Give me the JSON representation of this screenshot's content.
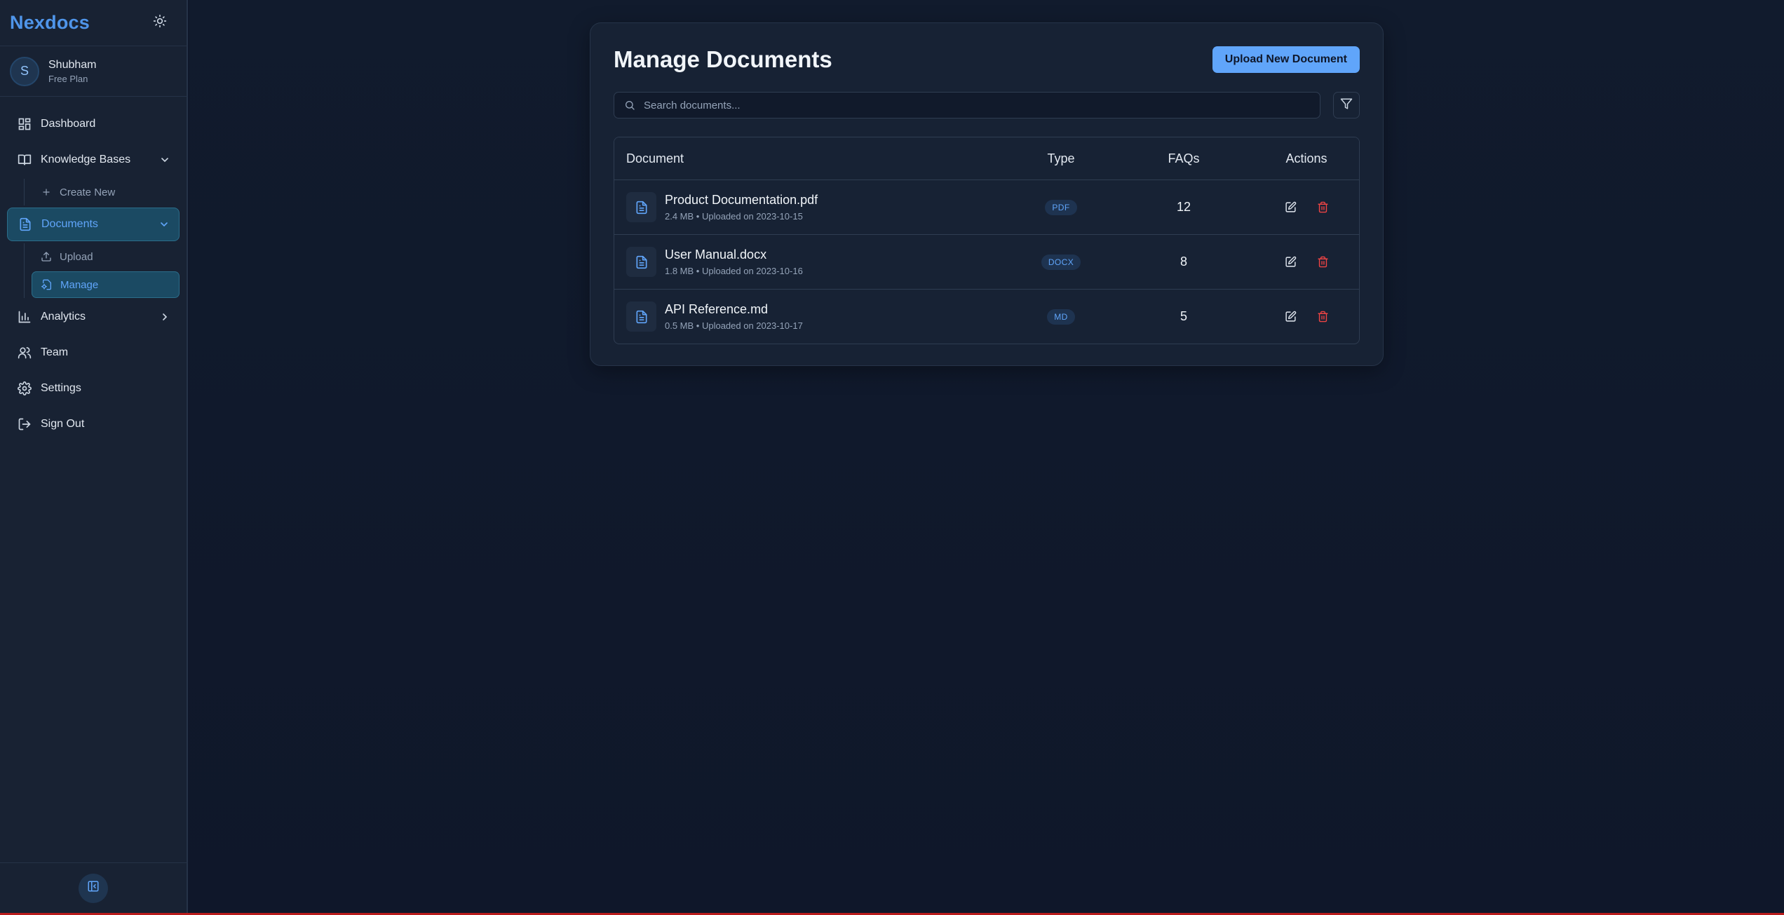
{
  "app": {
    "brand": "Nexdocs"
  },
  "user": {
    "initial": "S",
    "name": "Shubham",
    "plan": "Free Plan"
  },
  "sidebar": {
    "items": [
      {
        "label": "Dashboard",
        "icon": "dashboard-icon"
      },
      {
        "label": "Knowledge Bases",
        "icon": "book-icon",
        "expanded": true
      },
      {
        "label": "Create New",
        "icon": "plus-icon"
      },
      {
        "label": "Documents",
        "icon": "document-icon",
        "expanded": true,
        "active": true
      },
      {
        "label": "Upload",
        "icon": "upload-icon"
      },
      {
        "label": "Manage",
        "icon": "manage-icon",
        "active": true
      },
      {
        "label": "Analytics",
        "icon": "bar-chart-icon"
      },
      {
        "label": "Team",
        "icon": "users-icon"
      },
      {
        "label": "Settings",
        "icon": "gear-icon"
      },
      {
        "label": "Sign Out",
        "icon": "sign-out-icon"
      }
    ]
  },
  "main": {
    "title": "Manage Documents",
    "upload_button": "Upload New Document",
    "search_placeholder": "Search documents...",
    "table": {
      "headers": {
        "document": "Document",
        "type": "Type",
        "faqs": "FAQs",
        "actions": "Actions"
      },
      "rows": [
        {
          "name": "Product Documentation.pdf",
          "meta": "2.4 MB • Uploaded on 2023-10-15",
          "type": "PDF",
          "faqs": "12"
        },
        {
          "name": "User Manual.docx",
          "meta": "1.8 MB • Uploaded on 2023-10-16",
          "type": "DOCX",
          "faqs": "8"
        },
        {
          "name": "API Reference.md",
          "meta": "0.5 MB • Uploaded on 2023-10-17",
          "type": "MD",
          "faqs": "5"
        }
      ]
    }
  },
  "colors": {
    "accent": "#60a5fa",
    "danger": "#ef4444",
    "background": "#0f172a",
    "sidebar": "#182233"
  }
}
